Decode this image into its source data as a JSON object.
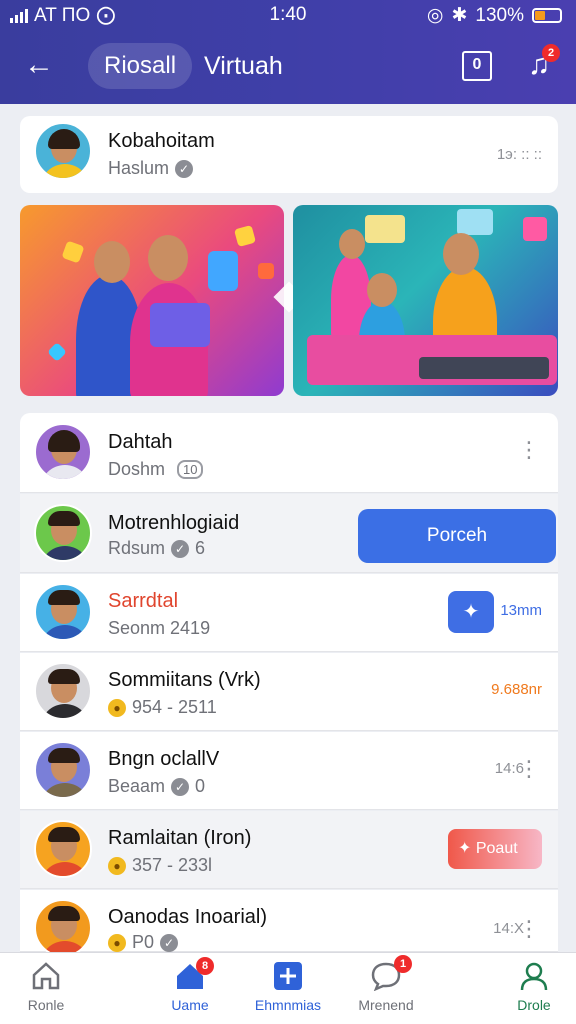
{
  "status": {
    "carrier": "AT ΠO",
    "time": "1:40",
    "battery": "130%"
  },
  "header": {
    "back_icon": "back-arrow-icon",
    "tab_active": "Riosall",
    "tab_other": "Virtuah",
    "music_badge": "2"
  },
  "top_item": {
    "name": "Kobahoitam",
    "sub": "Haslum",
    "meta": "1э: :: ::"
  },
  "list": [
    {
      "name": "Dahtah",
      "sub": "Doshm",
      "chip": "10",
      "right": ""
    },
    {
      "name": "Motrenhlogiaid",
      "sub": "Rdsum",
      "count": "6",
      "action": "Porceh"
    },
    {
      "name": "Sarrdtal",
      "sub": "Seonm 2419",
      "right": "13mm"
    },
    {
      "name": "Sommiitans (Vrk)",
      "sub": "954 - 2511",
      "right": "9.688nr"
    },
    {
      "name": "Bngn oclallV",
      "sub": "Beaam",
      "count": "0",
      "right": "14:6"
    },
    {
      "name": "Ramlaitan (Iron)",
      "sub": "357 - 233l",
      "right": "Poaut"
    },
    {
      "name": "Oanodas Inoarial)",
      "sub": "P0",
      "right": "14:X"
    }
  ],
  "bottom_nav": [
    {
      "label": "Ronle",
      "icon": "home-outline-icon"
    },
    {
      "label": "Uame",
      "icon": "home-filled-icon",
      "badge": "8"
    },
    {
      "label": "Ehmnmias",
      "icon": "plus-square-icon"
    },
    {
      "label": "Mrenend",
      "icon": "chat-bubble-icon",
      "badge": "1"
    },
    {
      "label": "Drole",
      "icon": "profile-icon"
    }
  ],
  "colors": {
    "header": "#3d3da6",
    "primary": "#3b6fe5",
    "accent_red": "#f0584a",
    "orange": "#f07a1e"
  }
}
